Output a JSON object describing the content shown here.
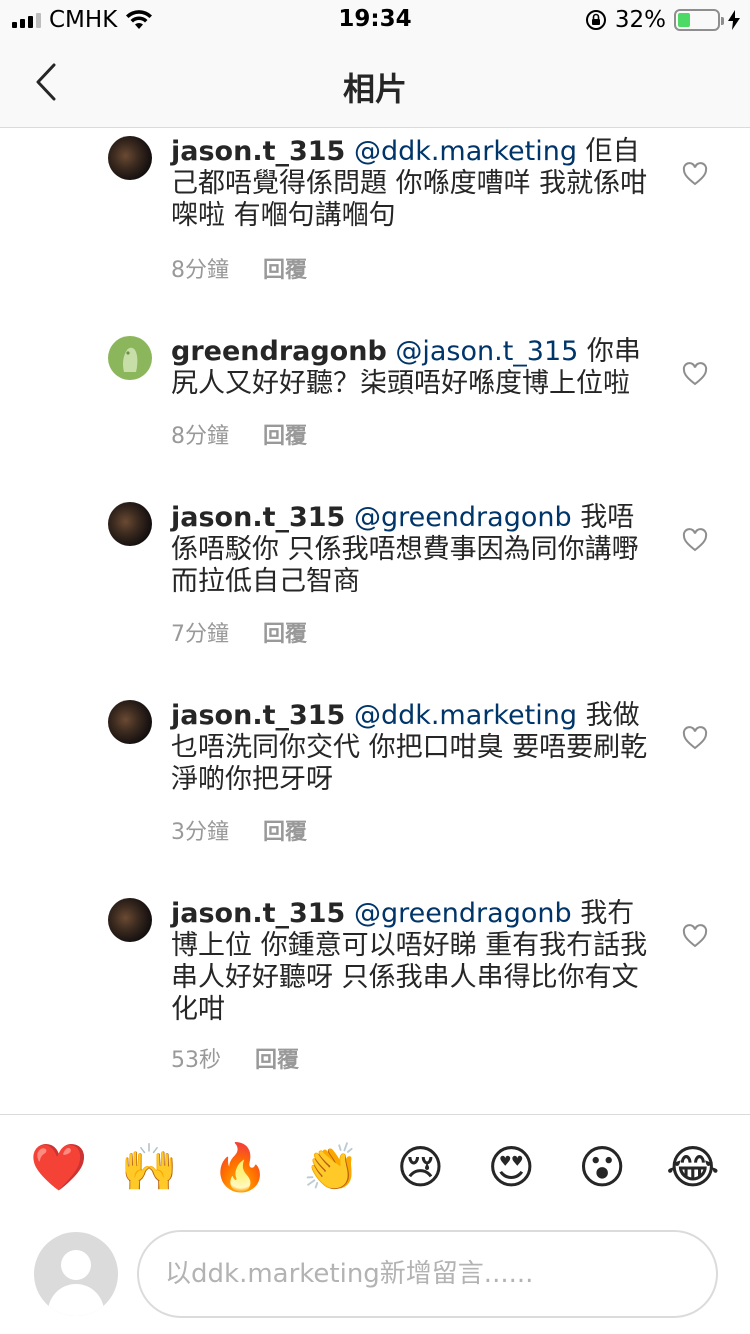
{
  "status": {
    "carrier": "CMHK",
    "time": "19:34",
    "battery": "32%",
    "battery_level": 0.32
  },
  "nav": {
    "title": "相片"
  },
  "comments": [
    {
      "username": "jason.t_315",
      "mention": "@ddk.marketing",
      "text": "佢自己都唔覺得係問題 你喺度嘈咩 我就係咁㗎啦 有嗰句講嗰句",
      "time": "8分鐘",
      "reply": "回覆"
    },
    {
      "username": "greendragonb",
      "mention": "@jason.t_315",
      "text": "你串尻人又好好聽？柒頭唔好喺度博上位啦",
      "time": "8分鐘",
      "reply": "回覆"
    },
    {
      "username": "jason.t_315",
      "mention": "@greendragonb",
      "text": "我唔係唔駁你 只係我唔想費事因為同你講嘢而拉低自己智商",
      "time": "7分鐘",
      "reply": "回覆"
    },
    {
      "username": "jason.t_315",
      "mention": "@ddk.marketing",
      "text": "我做乜唔洗同你交代 你把口咁臭 要唔要刷乾淨啲你把牙呀",
      "time": "3分鐘",
      "reply": "回覆"
    },
    {
      "username": "jason.t_315",
      "mention": "@greendragonb",
      "text": "我冇博上位 你鍾意可以唔好睇 重有我冇話我串人好好聽呀 只係我串人串得比你有文化咁",
      "time": "53秒",
      "reply": "回覆"
    }
  ],
  "emojis": [
    "❤️",
    "🙌",
    "🔥",
    "👏",
    "😢",
    "😍",
    "😮",
    "😂"
  ],
  "composer": {
    "placeholder": "以ddk.marketing新增留言......"
  },
  "colors": {
    "mention": "#003569",
    "meta": "#999999",
    "text": "#262626",
    "divider": "#dbdbdb",
    "battery": "#4cd964"
  }
}
